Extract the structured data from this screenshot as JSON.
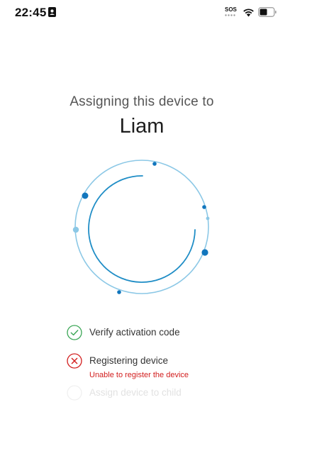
{
  "status_bar": {
    "time": "22:45",
    "sos": "SOS"
  },
  "assign": {
    "heading": "Assigning this device to",
    "child_name": "Liam"
  },
  "steps": [
    {
      "label": "Verify activation code",
      "status": "done",
      "icon": "check-circle-icon"
    },
    {
      "label": "Registering device",
      "status": "error",
      "icon": "x-circle-icon",
      "message": "Unable to register the device"
    },
    {
      "label": "Assign device to child",
      "status": "pending",
      "icon": "empty-circle-icon"
    }
  ],
  "colors": {
    "spinner_outer": "#8cc8e6",
    "spinner_inner": "#1f8dc6",
    "spinner_dot": "#1176bd",
    "success": "#3aa655",
    "error": "#d21d1d",
    "pending": "#e8e8e8"
  }
}
